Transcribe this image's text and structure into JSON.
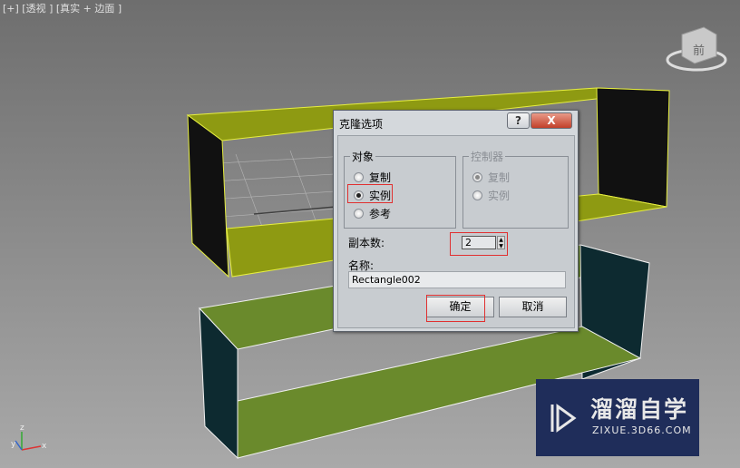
{
  "viewport": {
    "label": "[+] [透视 ] [真实 + 边面 ]",
    "viewcube_face": "前",
    "axes": {
      "x": "x",
      "y": "y",
      "z": "z"
    }
  },
  "dialog": {
    "title": "克隆选项",
    "help_label": "?",
    "close_label": "X",
    "object_group": {
      "title": "对象",
      "options": [
        "复制",
        "实例",
        "参考"
      ],
      "selected": "实例"
    },
    "controller_group": {
      "title": "控制器",
      "options": [
        "复制",
        "实例"
      ],
      "selected": "复制",
      "disabled": true
    },
    "copies_label": "副本数:",
    "copies_value": "2",
    "name_label": "名称:",
    "name_value": "Rectangle002",
    "ok_label": "确定",
    "cancel_label": "取消"
  },
  "watermark": {
    "title": "溜溜自学",
    "url": "ZIXUE.3D66.COM"
  },
  "colors": {
    "top_box": "#8e9a12",
    "bottom_box": "#6a8a2c",
    "highlight": "#e03030"
  }
}
